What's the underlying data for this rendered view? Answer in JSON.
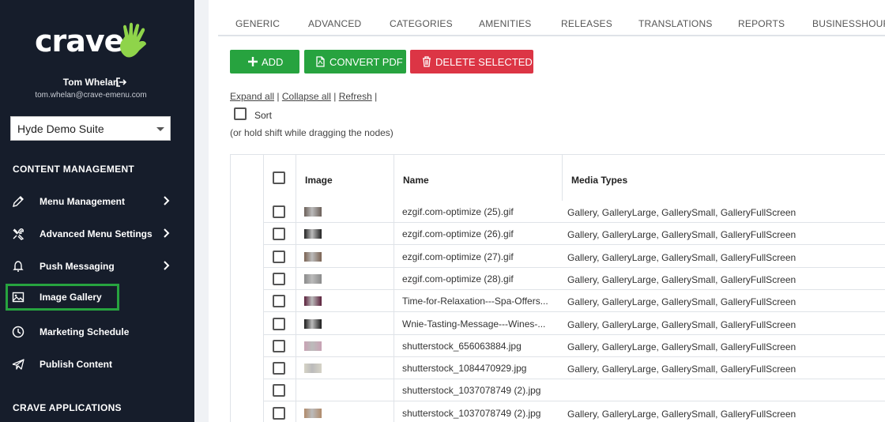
{
  "sidebar": {
    "logo_text": "crave",
    "user_name": "Tom Whelan",
    "user_email": "tom.whelan@crave-emenu.com",
    "suite_select": "Hyde Demo Suite",
    "section_content": "CONTENT MANAGEMENT",
    "section_apps": "CRAVE APPLICATIONS",
    "items": [
      {
        "label": "Menu Management",
        "icon": "pencil-icon",
        "has_chevron": true
      },
      {
        "label": "Advanced Menu Settings",
        "icon": "tools-icon",
        "has_chevron": true
      },
      {
        "label": "Push Messaging",
        "icon": "bell-icon",
        "has_chevron": true
      },
      {
        "label": "Image Gallery",
        "icon": "image-icon",
        "has_chevron": false,
        "active": true
      },
      {
        "label": "Marketing Schedule",
        "icon": "clock-icon",
        "has_chevron": false
      },
      {
        "label": "Publish Content",
        "icon": "paper-plane-icon",
        "has_chevron": false
      }
    ]
  },
  "tabs": [
    "GENERIC",
    "ADVANCED",
    "CATEGORIES",
    "AMENITIES",
    "RELEASES",
    "TRANSLATIONS",
    "REPORTS",
    "BUSINESSHOURS"
  ],
  "toolbar": {
    "add_label": "ADD",
    "pdf_label": "CONVERT PDF",
    "delete_label": "DELETE SELECTED"
  },
  "tree_links": {
    "expand": "Expand all",
    "collapse": "Collapse all",
    "refresh": "Refresh",
    "sep": "|"
  },
  "sort_label": "Sort",
  "hint": "(or hold shift while dragging the nodes)",
  "table": {
    "columns": [
      "Image",
      "Name",
      "Media Types"
    ],
    "rows": [
      {
        "name": "ezgif.com-optimize (25).gif",
        "media": "Gallery, GalleryLarge, GallerySmall, GalleryFullScreen",
        "thumb": "#6b5f58"
      },
      {
        "name": "ezgif.com-optimize (26).gif",
        "media": "Gallery, GalleryLarge, GallerySmall, GalleryFullScreen",
        "thumb": "#222222"
      },
      {
        "name": "ezgif.com-optimize (27).gif",
        "media": "Gallery, GalleryLarge, GallerySmall, GalleryFullScreen",
        "thumb": "#7a6252"
      },
      {
        "name": "ezgif.com-optimize (28).gif",
        "media": "Gallery, GalleryLarge, GallerySmall, GalleryFullScreen",
        "thumb": "#8a8a8a"
      },
      {
        "name": "Time-for-Relaxation---Spa-Offers...",
        "media": "Gallery, GalleryLarge, GallerySmall, GalleryFullScreen",
        "thumb": "#5a1f3a"
      },
      {
        "name": "Wnie-Tasting-Message---Wines-...",
        "media": "Gallery, GalleryLarge, GallerySmall, GalleryFullScreen",
        "thumb": "#1a1a1a"
      },
      {
        "name": "shutterstock_656063884.jpg",
        "media": "Gallery, GalleryLarge, GallerySmall, GalleryFullScreen",
        "thumb": "#c9a2b4"
      },
      {
        "name": "shutterstock_1084470929.jpg",
        "media": "Gallery, GalleryLarge, GallerySmall, GalleryFullScreen",
        "thumb": "#d6d3c6"
      },
      {
        "name": "shutterstock_1037078749 (2).jpg",
        "media": "",
        "thumb": ""
      },
      {
        "name": "shutterstock_1037078749 (2).jpg",
        "media": "Gallery, GalleryLarge, GallerySmall, GalleryFullScreen",
        "thumb": "#b08a6a"
      }
    ]
  },
  "colors": {
    "sidebar_bg": "#161d2b",
    "accent_green": "#27a33f",
    "danger_red": "#dc3545",
    "logo_hand": "#8fd44a"
  }
}
